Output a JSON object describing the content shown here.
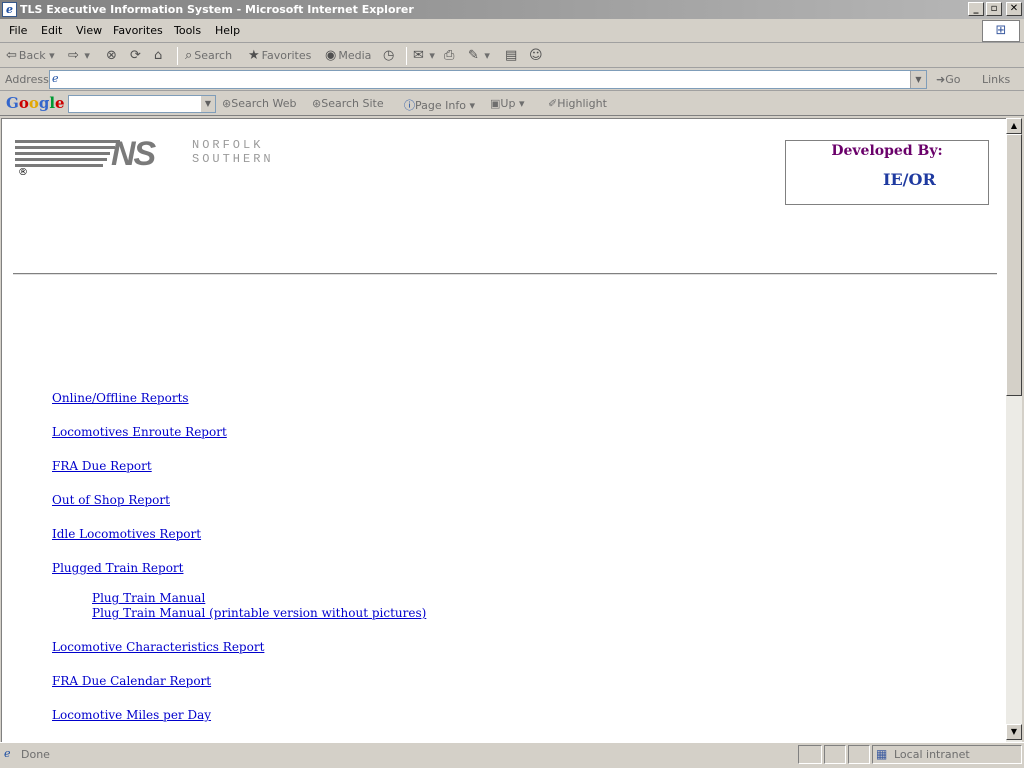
{
  "window": {
    "title": "TLS Executive Information System - Microsoft Internet Explorer"
  },
  "menu": [
    "File",
    "Edit",
    "View",
    "Favorites",
    "Tools",
    "Help"
  ],
  "toolbar": {
    "back": "Back",
    "search": "Search",
    "favorites": "Favorites",
    "media": "Media"
  },
  "address": {
    "label": "Address",
    "value": "",
    "go": "Go",
    "links": "Links"
  },
  "google": {
    "logo": "Google",
    "search_web": "Search Web",
    "search_site": "Search Site",
    "page_info": "Page Info",
    "up": "Up",
    "highlight": "Highlight"
  },
  "page": {
    "brand_line1": "NORFOLK",
    "brand_line2": "SOUTHERN",
    "brand_mark": "NS",
    "registered": "®",
    "developed_by": "Developed By:",
    "developer": "IE/OR",
    "links": [
      "Online/Offline Reports",
      "Locomotives Enroute Report",
      "FRA Due Report",
      "Out of Shop Report",
      "Idle Locomotives Report",
      "Plugged Train Report",
      "Plug Train Manual",
      "Plug Train Manual (printable version without pictures)",
      "Locomotive Characteristics Report",
      "FRA Due Calendar Report",
      "Locomotive Miles per Day"
    ]
  },
  "status": {
    "text": "Done",
    "zone": "Local intranet"
  }
}
